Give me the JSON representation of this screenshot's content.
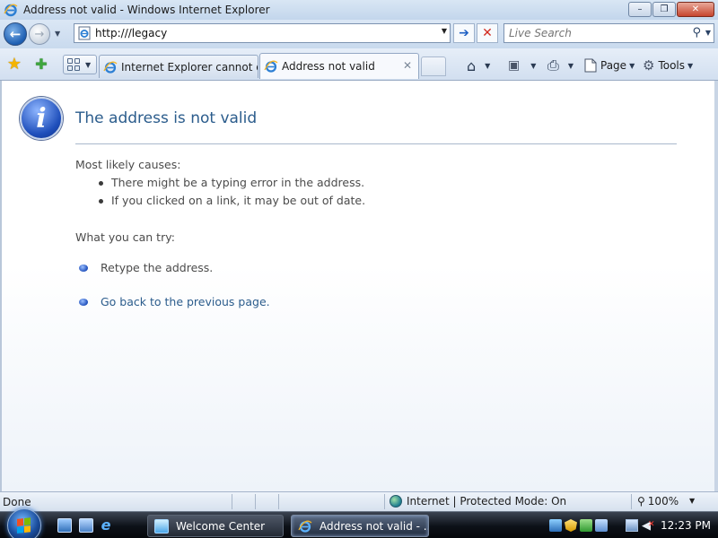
{
  "window": {
    "title": "Address not valid - Windows Internet Explorer",
    "minimize_glyph": "–",
    "maximize_glyph": "❐",
    "close_glyph": "✕"
  },
  "toolbar": {
    "back_glyph": "←",
    "forward_glyph": "→",
    "address_value": "http:///legacy",
    "go_glyph": "➔",
    "stop_glyph": "✕",
    "search_placeholder": "Live Search",
    "search_icon_glyph": "⚲"
  },
  "tabs": [
    {
      "label": "Internet Explorer cannot di...",
      "active": false
    },
    {
      "label": "Address not valid",
      "active": true,
      "close_glyph": "✕"
    }
  ],
  "commands": {
    "home_glyph": "⌂",
    "feeds_glyph": "▣",
    "print_glyph": "⎙",
    "page_label": "Page",
    "tools_label": "Tools"
  },
  "page": {
    "info_glyph": "i",
    "title": "The address is not valid",
    "causes_label": "Most likely causes:",
    "causes": [
      "There might be a typing error in the address.",
      "If you clicked on a link, it may be out of date."
    ],
    "try_label": "What you can try:",
    "try_items": [
      "Retype the address.",
      "Go back to the previous page."
    ]
  },
  "status": {
    "text": "Done",
    "zone": "Internet | Protected Mode: On",
    "zoom": "100%"
  },
  "taskbar": {
    "buttons": [
      "Welcome Center",
      "Address not valid - ..."
    ],
    "clock": "12:23 PM"
  },
  "colors": {
    "link": "#2b5c8c",
    "accent_blue": "#1f4fbb",
    "taskbar_dark": "#0d1118"
  },
  "icons": [
    "ie-logo-icon",
    "back-icon",
    "forward-icon",
    "page-icon",
    "go-icon",
    "stop-icon",
    "search-icon",
    "favorites-star-icon",
    "add-favorites-icon",
    "quick-tabs-icon",
    "home-icon",
    "feeds-icon",
    "print-icon",
    "page-menu-icon",
    "tools-gear-icon",
    "info-icon",
    "globe-icon",
    "zoom-icon",
    "start-orb-icon",
    "volume-muted-icon"
  ]
}
